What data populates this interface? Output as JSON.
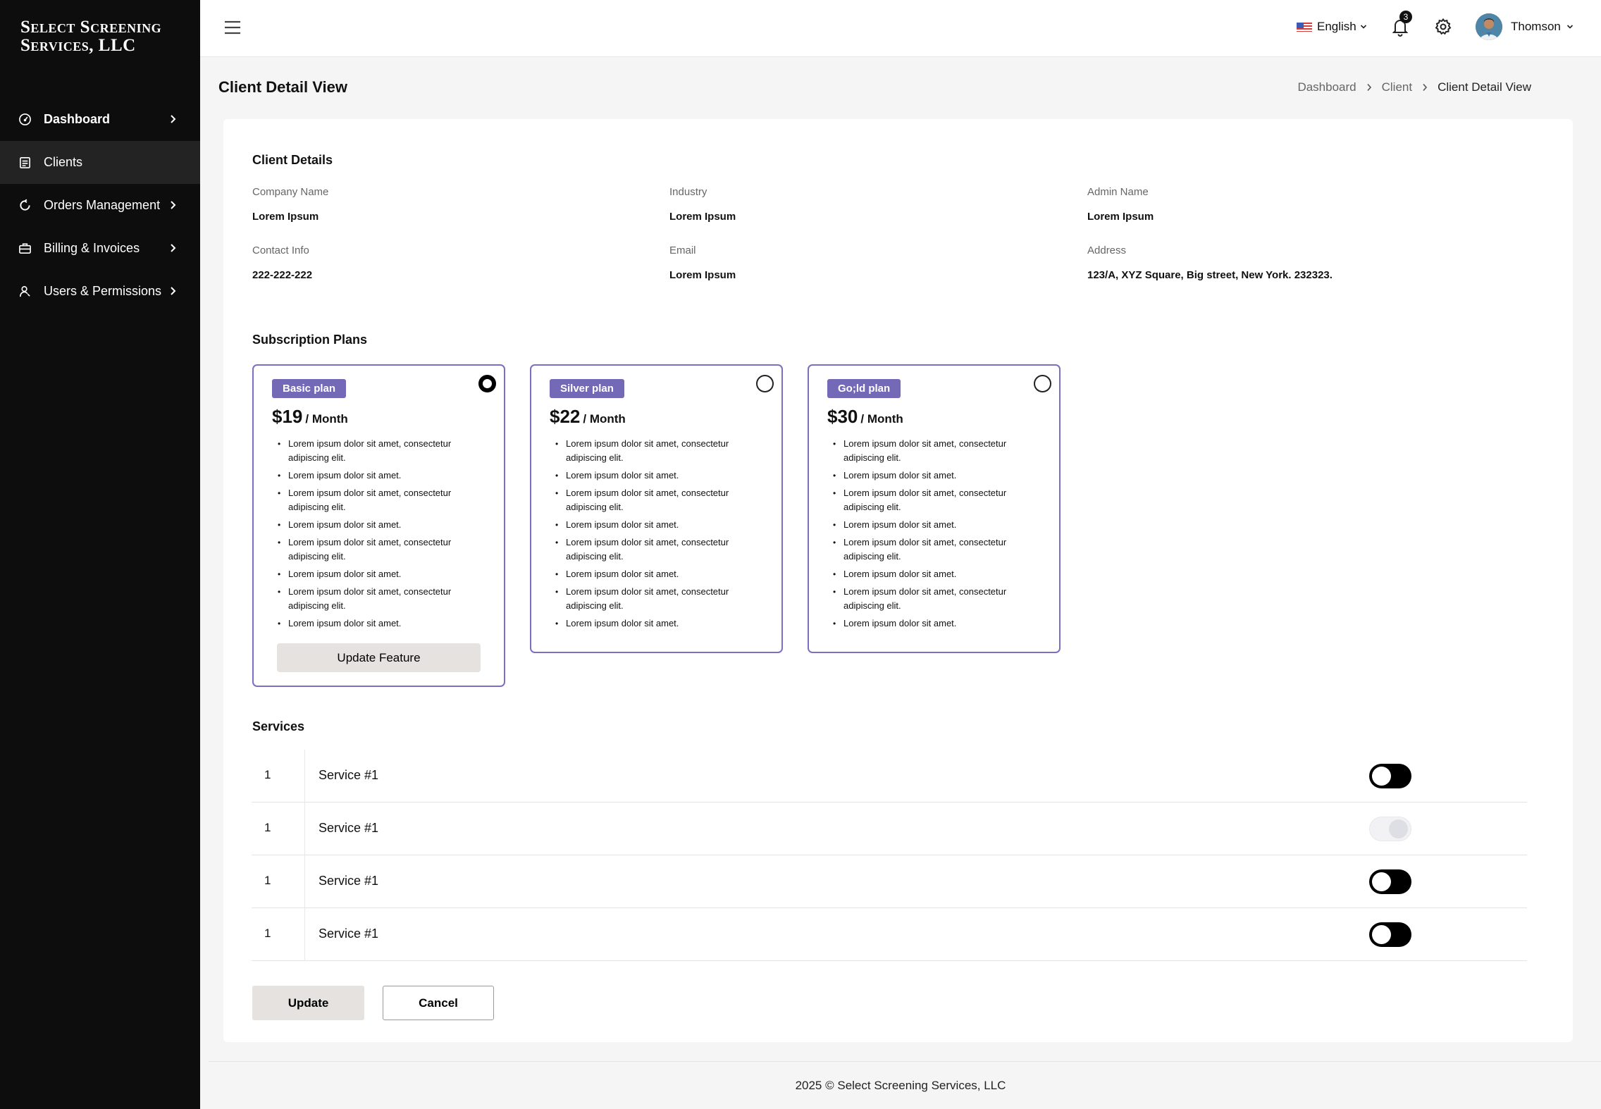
{
  "brand": {
    "line1": "Select Screening",
    "line2": "Services, LLC"
  },
  "sidebar": {
    "items": [
      {
        "label": "Dashboard",
        "icon": "gauge-icon",
        "chevron": true
      },
      {
        "label": "Clients",
        "icon": "clipboard-icon",
        "chevron": false
      },
      {
        "label": "Orders Management",
        "icon": "refresh-icon",
        "chevron": true
      },
      {
        "label": "Billing & Invoices",
        "icon": "briefcase-icon",
        "chevron": true
      },
      {
        "label": "Users & Permissions",
        "icon": "user-key-icon",
        "chevron": true
      }
    ]
  },
  "topbar": {
    "language": "English",
    "notification_count": "3",
    "user_name": "Thomson"
  },
  "page": {
    "title": "Client Detail View",
    "breadcrumb": [
      "Dashboard",
      "Client",
      "Client Detail View"
    ]
  },
  "client_details": {
    "title": "Client Details",
    "fields": [
      {
        "label": "Company Name",
        "value": "Lorem Ipsum"
      },
      {
        "label": "Industry",
        "value": "Lorem Ipsum"
      },
      {
        "label": "Admin Name",
        "value": "Lorem Ipsum"
      },
      {
        "label": "Contact Info",
        "value": "222-222-222"
      },
      {
        "label": "Email",
        "value": "Lorem Ipsum"
      },
      {
        "label": "Address",
        "value": "123/A, XYZ Square, Big street, New York. 232323."
      }
    ]
  },
  "subscription": {
    "title": "Subscription Plans",
    "per_label": "/ Month",
    "button_label": "Update Feature",
    "features": [
      "Lorem ipsum dolor sit amet, consectetur adipiscing elit.",
      "Lorem ipsum dolor sit amet.",
      "Lorem ipsum dolor sit amet, consectetur adipiscing elit.",
      "Lorem ipsum dolor sit amet.",
      "Lorem ipsum dolor sit amet, consectetur adipiscing elit.",
      "Lorem ipsum dolor sit amet.",
      "Lorem ipsum dolor sit amet, consectetur adipiscing elit.",
      "Lorem ipsum dolor sit amet."
    ],
    "plans": [
      {
        "name": "Basic plan",
        "price": "$19",
        "selected": true
      },
      {
        "name": "Silver plan",
        "price": "$22",
        "selected": false
      },
      {
        "name": "Go;ld plan",
        "price": "$30",
        "selected": false
      }
    ]
  },
  "services": {
    "title": "Services",
    "rows": [
      {
        "num": "1",
        "name": "Service #1",
        "enabled": true,
        "disabled": false
      },
      {
        "num": "1",
        "name": "Service #1",
        "enabled": false,
        "disabled": true
      },
      {
        "num": "1",
        "name": "Service #1",
        "enabled": true,
        "disabled": false
      },
      {
        "num": "1",
        "name": "Service #1",
        "enabled": true,
        "disabled": false
      }
    ]
  },
  "actions": {
    "update": "Update",
    "cancel": "Cancel"
  },
  "footer": {
    "text": "2025 © Select Screening Services, LLC"
  },
  "colors": {
    "sidebar_bg": "#0d0d0d",
    "accent": "#7469b6",
    "page_bg": "#f5f5f6"
  }
}
